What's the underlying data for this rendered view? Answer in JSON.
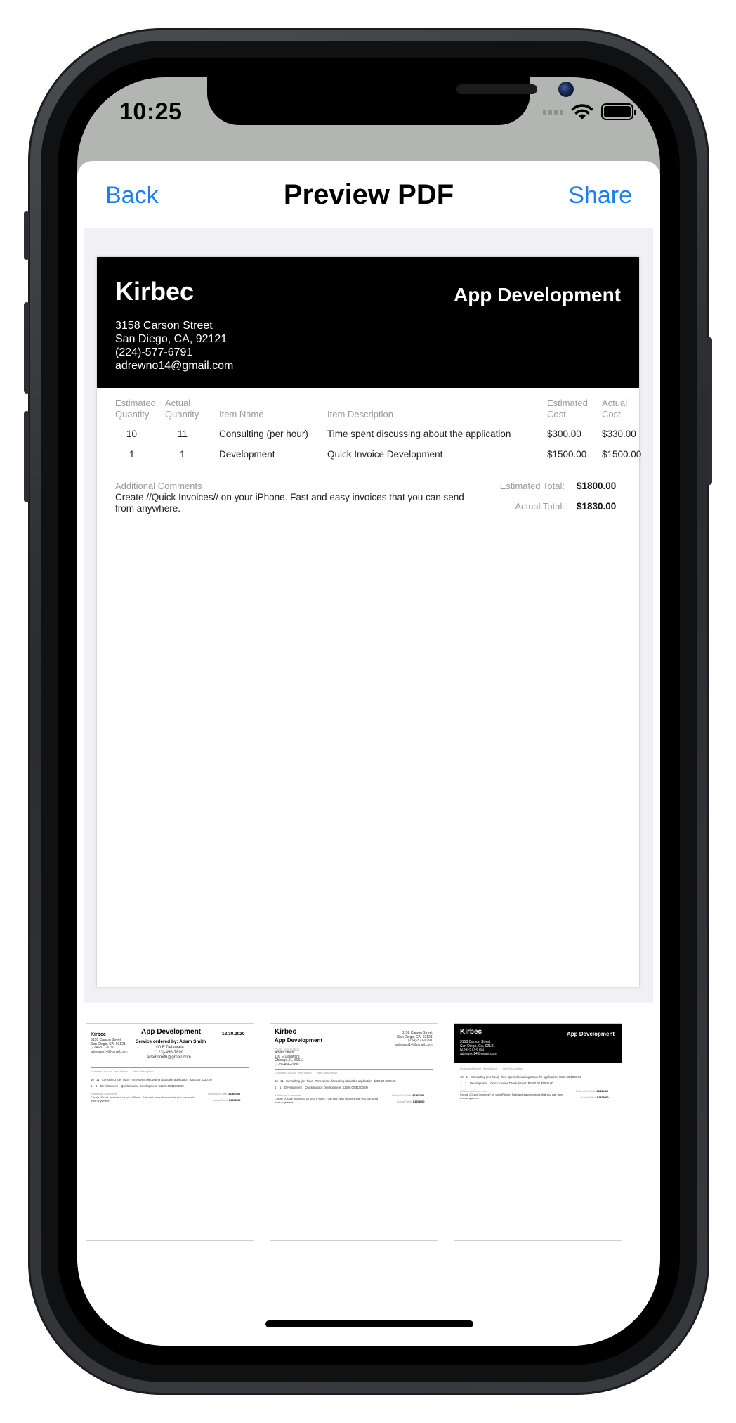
{
  "status": {
    "time": "10:25"
  },
  "nav": {
    "back_label": "Back",
    "title": "Preview PDF",
    "share_label": "Share"
  },
  "invoice": {
    "company": "Kirbec",
    "title": "App Development",
    "address": [
      "3158 Carson Street",
      "San Diego, CA, 92121",
      "(224)-577-6791",
      "adrewno14@gmail.com"
    ],
    "headers": {
      "est_qty": [
        "Estimated",
        "Quantity"
      ],
      "act_qty": [
        "Actual",
        "Quantity"
      ],
      "item_name": "Item Name",
      "item_desc": "Item Description",
      "est_cost": [
        "Estimated",
        "Cost"
      ],
      "act_cost": [
        "Actual",
        "Cost"
      ]
    },
    "rows": [
      {
        "est_qty": "10",
        "act_qty": "11",
        "name": "Consulting (per hour)",
        "desc": "Time spent discussing about the application",
        "est_cost": "$300.00",
        "act_cost": "$330.00"
      },
      {
        "est_qty": "1",
        "act_qty": "1",
        "name": "Development",
        "desc": "Quick Invoice Development",
        "est_cost": "$1500.00",
        "act_cost": "$1500.00"
      }
    ],
    "comments_label": "Additional Comments",
    "comments": "Create //Quick Invoices// on your iPhone. Fast and easy invoices that you can send from anywhere.",
    "estimated_total_label": "Estimated Total:",
    "estimated_total": "$1800.00",
    "actual_total_label": "Actual Total:",
    "actual_total": "$1830.00"
  },
  "thumbnails": [
    {
      "company": "Kirbec",
      "title": "App Development",
      "date": "12.30.2020",
      "client_line": "Service ordered by: Adam Smith",
      "client_address": [
        "100 E Delaware",
        "(123)-456-7890",
        "adamsmith@gmail.com"
      ],
      "address": [
        "3158 Carson Street",
        "San Diego, CA, 92121",
        "(224)-577-6791",
        "adrewno14@gmail.com"
      ]
    },
    {
      "company": "Kirbec",
      "title": "App Development",
      "client_label": "Client Information",
      "client_info": [
        "Adam Smith",
        "100 E Delaware",
        "Chicago, IL, 60611",
        "(123)-456-7890"
      ],
      "address": [
        "3158 Carson Street",
        "San Diego, CA, 92121",
        "(224)-577-6791",
        "adrewno14@gmail.com"
      ]
    },
    {
      "company": "Kirbec",
      "title": "App Development",
      "address": [
        "3158 Carson Street",
        "San Diego, CA, 92121",
        "(224)-577-6791",
        "adrewno14@gmail.com"
      ]
    }
  ],
  "thumb_table": {
    "r1": [
      "10",
      "11",
      "Consulting (per hour)",
      "Time spent discussing about the application",
      "$300.00",
      "$330.00"
    ],
    "r2": [
      "1",
      "1",
      "Development",
      "Quick Invoice Development",
      "$1500.00",
      "$1500.00"
    ],
    "comment_lines": [
      "Create //Quick Invoices// on your iPhone. Fast and easy invoices that you can send",
      "from anywhere."
    ]
  }
}
